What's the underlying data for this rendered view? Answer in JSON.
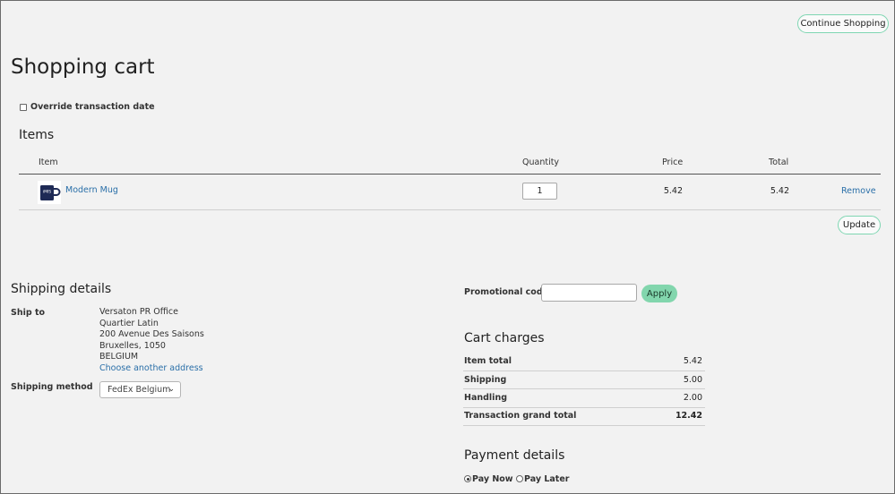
{
  "header": {
    "continue_shopping": "Continue Shopping",
    "title": "Shopping cart"
  },
  "override_label": "Override transaction date",
  "items_section": {
    "heading": "Items",
    "columns": [
      "Item",
      "Quantity",
      "Price",
      "Total"
    ],
    "rows": [
      {
        "name": "Modern Mug",
        "image_label": "iMIS",
        "quantity": "1",
        "price": "5.42",
        "total": "5.42",
        "remove": "Remove"
      }
    ],
    "update": "Update"
  },
  "shipping": {
    "heading": "Shipping details",
    "ship_to_label": "Ship to",
    "address": [
      "Versaton PR Office",
      "Quartier Latin",
      "200 Avenue Des Saisons",
      "Bruxelles, 1050",
      "BELGIUM"
    ],
    "choose_another": "Choose another address",
    "method_label": "Shipping method",
    "method_value": "FedEx Belgium"
  },
  "promo": {
    "label": "Promotional code",
    "value": "",
    "apply": "Apply"
  },
  "cart_charges": {
    "heading": "Cart charges",
    "rows": [
      {
        "label": "Item total",
        "value": "5.42"
      },
      {
        "label": "Shipping",
        "value": "5.00"
      },
      {
        "label": "Handling",
        "value": "2.00"
      },
      {
        "label": "Transaction grand total",
        "value": "12.42"
      }
    ]
  },
  "payment": {
    "heading": "Payment details",
    "options": [
      "Pay Now",
      "Pay Later"
    ],
    "selected": "Pay Now"
  },
  "colors": {
    "accent_border": "#7fd6b2",
    "apply_bg": "#82d6ad",
    "link": "#2a6fa8",
    "background": "#f2f2f2"
  }
}
